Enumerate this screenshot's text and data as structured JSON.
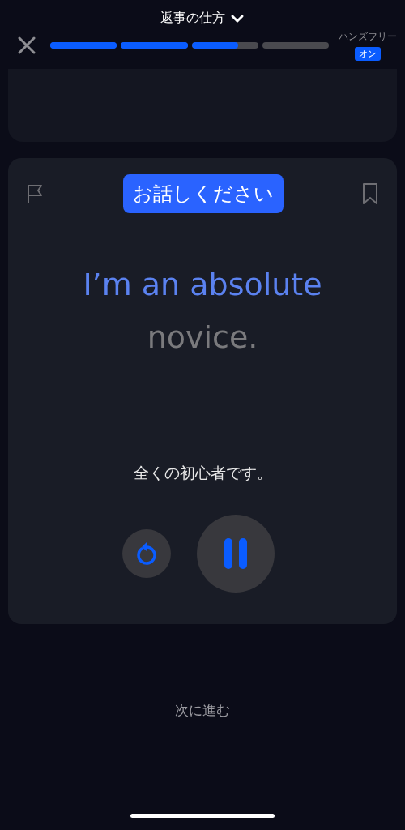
{
  "header": {
    "title": "返事の仕方",
    "progress": [
      {
        "kind": "done",
        "level": 1
      },
      {
        "kind": "done",
        "level": 1
      },
      {
        "kind": "current",
        "level": 0.7
      },
      {
        "kind": "todo"
      }
    ],
    "handsfree": {
      "label": "ハンズフリー",
      "toggle": "オン",
      "on": true
    }
  },
  "card": {
    "prompt": "お話しください",
    "sentence": [
      {
        "text": "I’m an absolute",
        "spoken": true
      },
      {
        "text": "novice.",
        "spoken": false
      }
    ],
    "translation": "全くの初心者です。",
    "playing": true
  },
  "next": "次に進む"
}
